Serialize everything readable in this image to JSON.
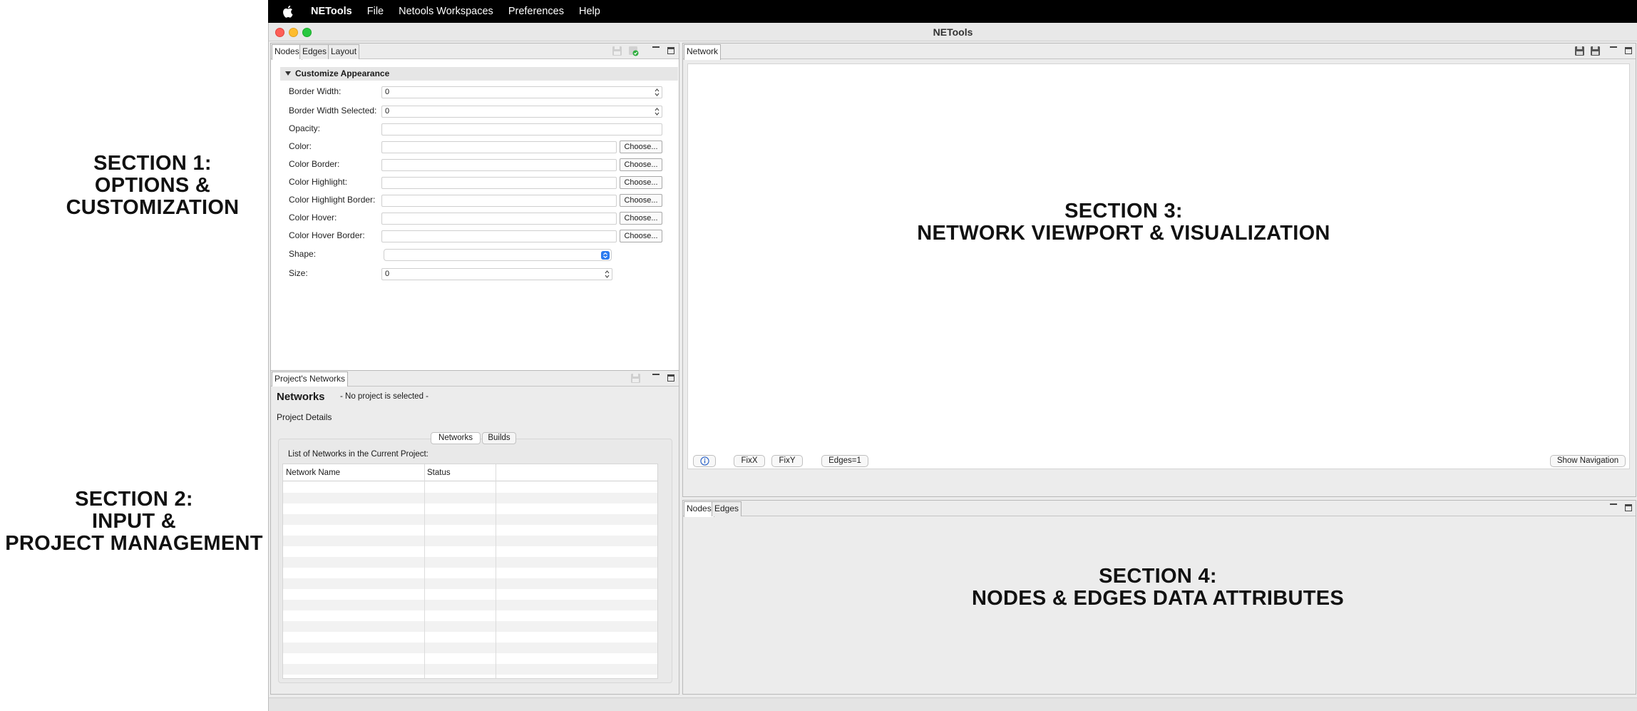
{
  "annotations": {
    "section1": "SECTION 1:\nOPTIONS &\nCUSTOMIZATION",
    "section2": "SECTION 2:\nINPUT &\nPROJECT MANAGEMENT",
    "section3": "SECTION 3:\nNETWORK VIEWPORT & VISUALIZATION",
    "section4": "SECTION 4:\nNODES & EDGES DATA ATTRIBUTES"
  },
  "menubar": {
    "app": "NETools",
    "items": [
      "File",
      "Netools Workspaces",
      "Preferences",
      "Help"
    ]
  },
  "window": {
    "title": "NETools"
  },
  "options_panel": {
    "tabs": [
      "Nodes",
      "Edges",
      "Layout"
    ],
    "section_title": "Customize Appearance",
    "fields": {
      "border_width": {
        "label": "Border Width:",
        "value": "0"
      },
      "border_width_selected": {
        "label": "Border Width Selected:",
        "value": "0"
      },
      "opacity": {
        "label": "Opacity:",
        "value": ""
      },
      "color": {
        "label": "Color:",
        "value": ""
      },
      "color_border": {
        "label": "Color Border:",
        "value": ""
      },
      "color_highlight": {
        "label": "Color Highlight:",
        "value": ""
      },
      "color_highlight_border": {
        "label": "Color Highlight Border:",
        "value": ""
      },
      "color_hover": {
        "label": "Color Hover:",
        "value": ""
      },
      "color_hover_border": {
        "label": "Color Hover Border:",
        "value": ""
      },
      "shape": {
        "label": "Shape:",
        "value": ""
      },
      "size": {
        "label": "Size:",
        "value": "0"
      }
    },
    "choose_label": "Choose..."
  },
  "projects_panel": {
    "tab": "Project's Networks",
    "heading": "Networks",
    "no_project": "- No project is selected -",
    "details_label": "Project Details",
    "subtabs": [
      "Networks",
      "Builds"
    ],
    "list_label": "List of Networks in the Current Project:",
    "columns": [
      "Network Name",
      "Status"
    ]
  },
  "network_panel": {
    "tab": "Network",
    "buttons": {
      "fixx": "FixX",
      "fixy": "FixY",
      "edges": "Edges=1",
      "show_nav": "Show Navigation"
    }
  },
  "data_panel": {
    "tabs": [
      "Nodes",
      "Edges"
    ]
  },
  "colors": {
    "menubar": "#000000",
    "chrome": "#ececec",
    "accent": "#2b7bf0"
  }
}
